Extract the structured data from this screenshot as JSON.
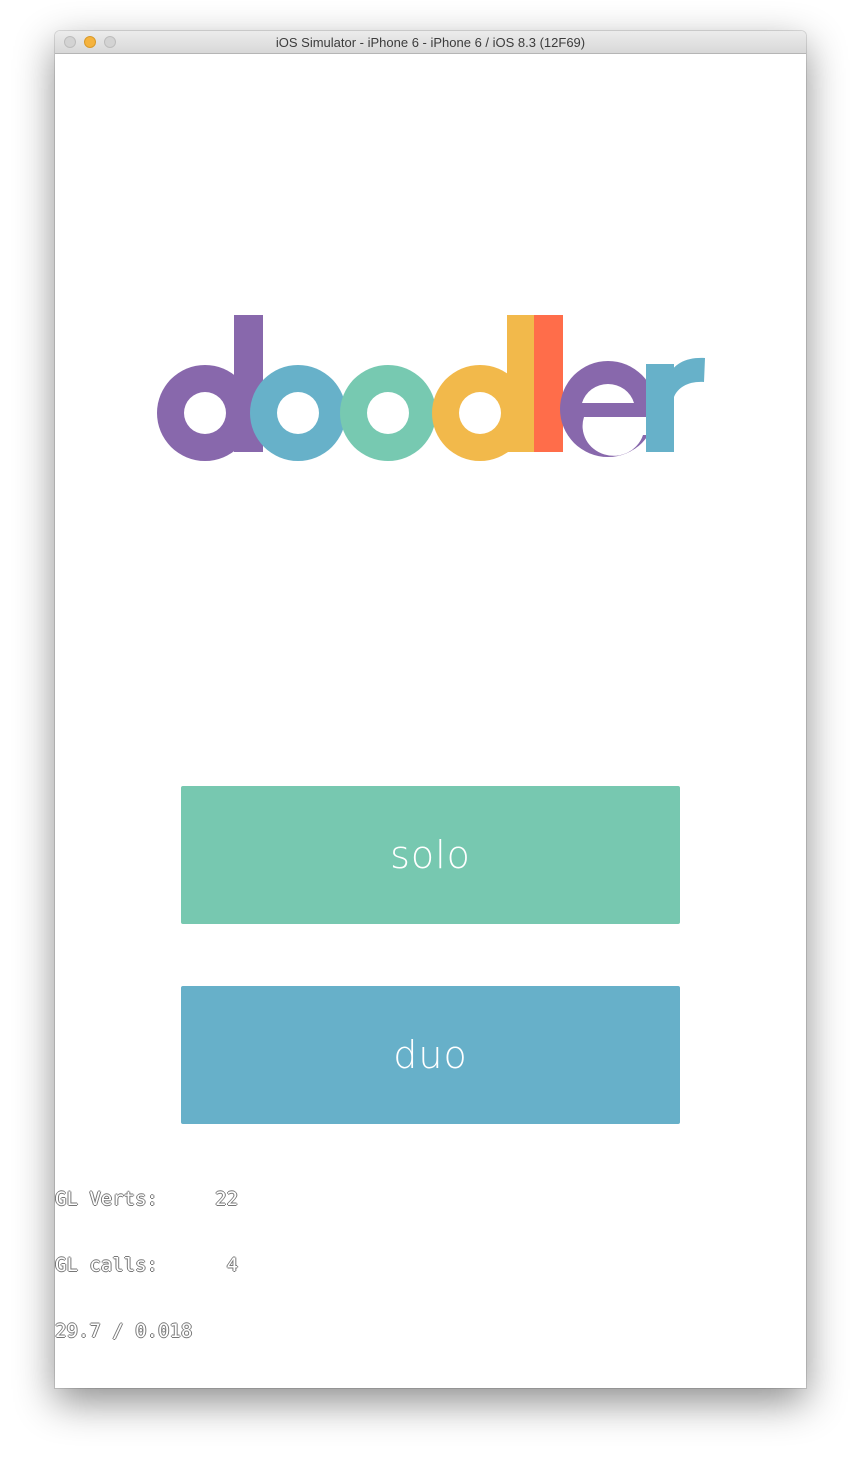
{
  "window": {
    "title": "iOS Simulator - iPhone 6 - iPhone 6 / iOS 8.3 (12F69)"
  },
  "app": {
    "logo_text": "doodler",
    "logo_colors": {
      "purple": "#8868ac",
      "blue": "#67b1c9",
      "teal": "#77c9b1",
      "yellow": "#f2b94b",
      "orange": "#ff6d4a"
    },
    "buttons": {
      "solo": {
        "label": "solo",
        "color": "#77c8b0"
      },
      "duo": {
        "label": "duo",
        "color": "#67b0c9"
      }
    }
  },
  "debug_stats": {
    "gl_verts_label": "GL Verts:",
    "gl_verts_value": "22",
    "gl_calls_label": "GL calls:",
    "gl_calls_value": "4",
    "fps_line": "29.7 / 0.018"
  }
}
